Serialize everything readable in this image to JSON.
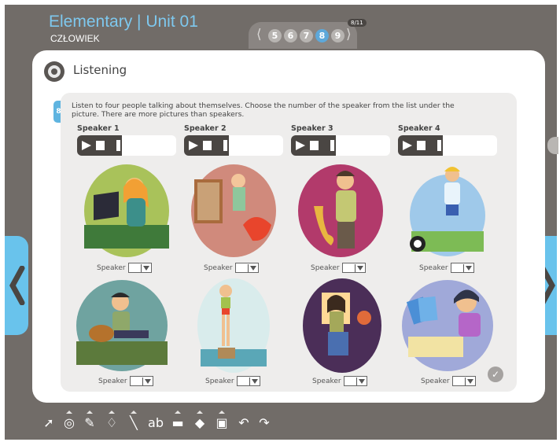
{
  "header": {
    "title": "Elementary | Unit 01",
    "subtitle": "CZŁOWIEK"
  },
  "pager": {
    "pages": [
      "5",
      "6",
      "7",
      "8",
      "9"
    ],
    "active": "8",
    "counter": "8/11"
  },
  "section": {
    "title": "Listening",
    "exercise_label": "8"
  },
  "instruction": "Listen to four people talking about themselves. Choose the number of the speaker from the list under the picture. There are more pictures than speakers.",
  "speakers": [
    {
      "label": "Speaker 1"
    },
    {
      "label": "Speaker 2"
    },
    {
      "label": "Speaker 3"
    },
    {
      "label": "Speaker 4"
    }
  ],
  "pictures": [
    {
      "select_label": "Speaker",
      "selected": ""
    },
    {
      "select_label": "Speaker",
      "selected": ""
    },
    {
      "select_label": "Speaker",
      "selected": ""
    },
    {
      "select_label": "Speaker",
      "selected": ""
    },
    {
      "select_label": "Speaker",
      "selected": ""
    },
    {
      "select_label": "Speaker",
      "selected": ""
    },
    {
      "select_label": "Speaker",
      "selected": ""
    },
    {
      "select_label": "Speaker",
      "selected": ""
    }
  ],
  "toolbar": {
    "tools": [
      "pointer-icon",
      "zoom-icon",
      "pen-icon",
      "ink-drop-icon",
      "line-icon",
      "text-icon",
      "rectangle-icon",
      "eraser-icon",
      "save-icon",
      "undo-icon",
      "redo-icon"
    ]
  },
  "colors": {
    "background": "#716c68",
    "accent": "#69c3ec",
    "title": "#7ec8ee",
    "panel": "#eeedec"
  }
}
